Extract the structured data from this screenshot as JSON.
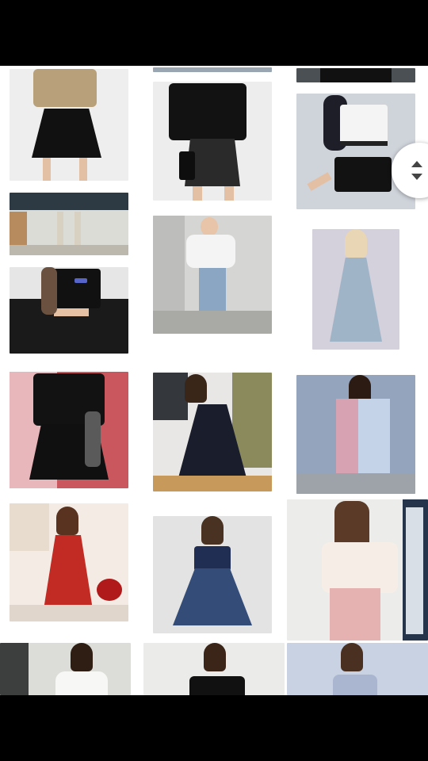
{
  "gallery": {
    "images": [
      {
        "subject": "plaid-shirt-black-skirt"
      },
      {
        "subject": "black-tee-plaid-skirt"
      },
      {
        "subject": "white-crop-black-shorts"
      },
      {
        "subject": "hallway-sneakers"
      },
      {
        "subject": "white-hoodie-jeans"
      },
      {
        "subject": "blue-floral-dress"
      },
      {
        "subject": "black-crop-leather-skirt"
      },
      {
        "subject": "black-tee-pleated-skirt"
      },
      {
        "subject": "black-lace-dress"
      },
      {
        "subject": "blue-pink-patchwork-dress"
      },
      {
        "subject": "red-offshoulder-dress"
      },
      {
        "subject": "navy-sequin-dress"
      },
      {
        "subject": "floral-blouse-pink-skirt"
      },
      {
        "subject": "white-lace-top"
      },
      {
        "subject": "black-offshoulder-top"
      },
      {
        "subject": "blue-tulle-dress"
      }
    ]
  },
  "colors": {
    "background": "#000000",
    "grid": "#ffffff"
  },
  "scroll_handle": {
    "icon": "up-down-arrows-icon"
  }
}
